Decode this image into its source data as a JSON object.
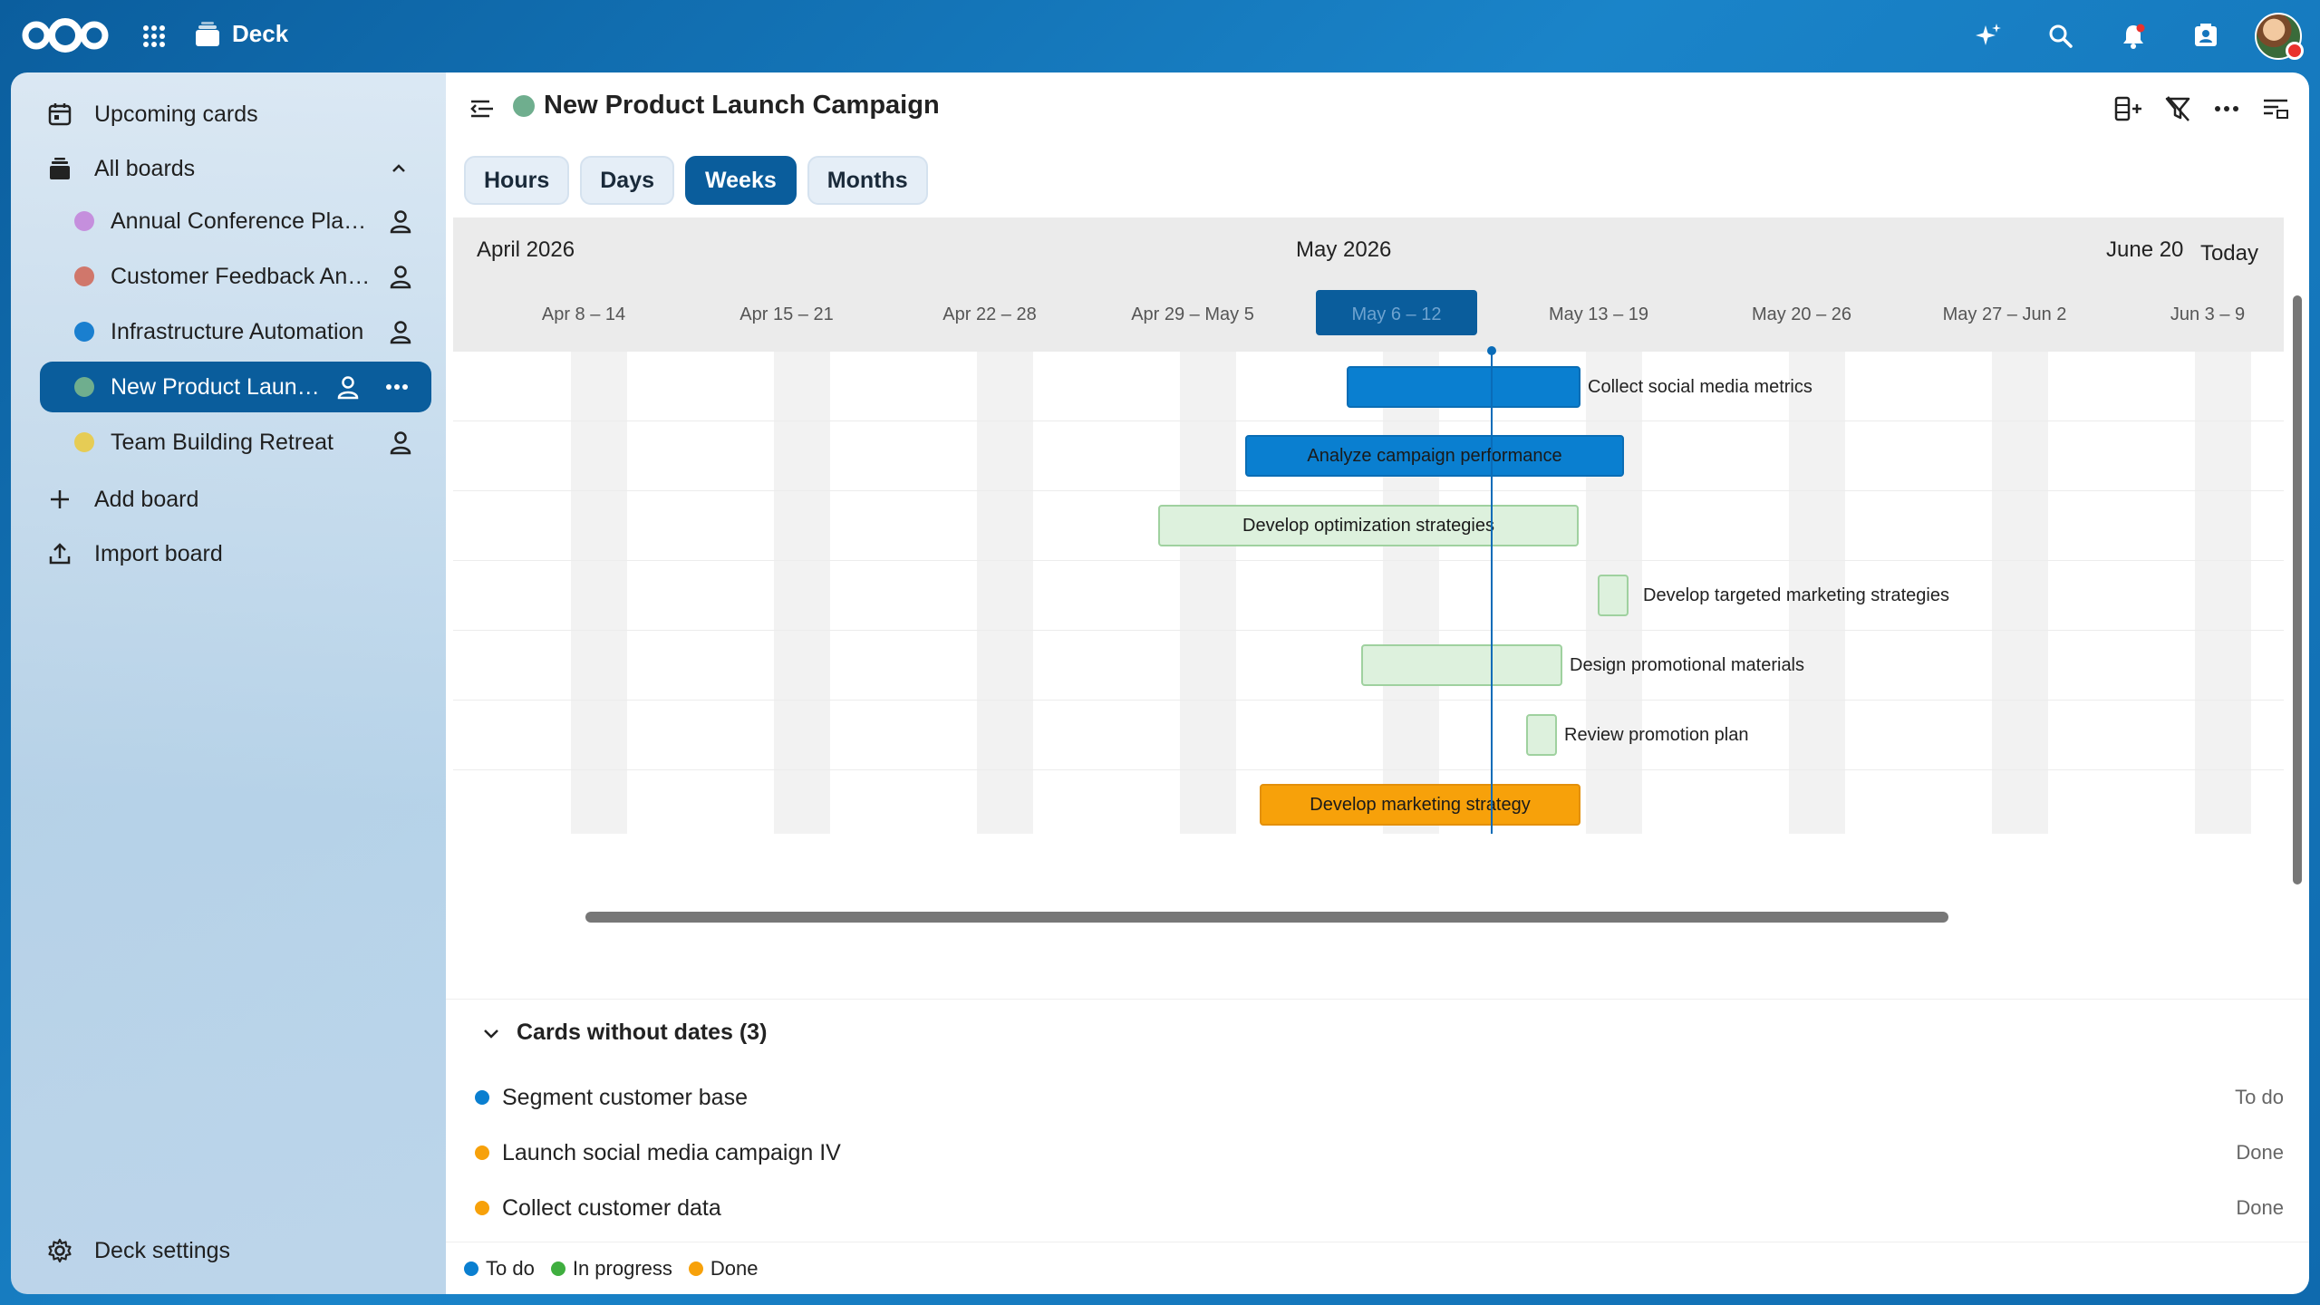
{
  "topbar": {
    "app_name": "Deck",
    "icons": [
      "assistant-icon",
      "search-icon",
      "notifications-icon",
      "contacts-icon",
      "avatar"
    ]
  },
  "sidebar": {
    "upcoming": "Upcoming cards",
    "all_boards": "All boards",
    "boards": [
      {
        "name": "Annual Conference Planning",
        "color": "#c58fdd"
      },
      {
        "name": "Customer Feedback Analy...",
        "color": "#d0776b"
      },
      {
        "name": "Infrastructure Automation",
        "color": "#1a7fcf"
      },
      {
        "name": "New Product Launch ...",
        "color": "#6fae8e"
      },
      {
        "name": "Team Building Retreat",
        "color": "#e6cc55"
      }
    ],
    "add_board": "Add board",
    "import_board": "Import board",
    "deck_settings": "Deck settings"
  },
  "board": {
    "title": "New Product Launch Campaign",
    "color": "#6fae8e"
  },
  "view_tabs": [
    "Hours",
    "Days",
    "Weeks",
    "Months"
  ],
  "active_tab": "Weeks",
  "gantt": {
    "months": [
      "April 2026",
      "May 2026",
      "June 20"
    ],
    "today_label": "Today",
    "weeks": [
      "Apr 8 – 14",
      "Apr 15 – 21",
      "Apr 22 – 28",
      "Apr 29 – May 5",
      "May 6 – 12",
      "May 13 – 19",
      "May 20 – 26",
      "May 27 – Jun 2",
      "Jun 3 – 9"
    ],
    "selected_week": "May 6 – 12",
    "tasks": [
      {
        "name": "Collect social media metrics",
        "status": "todo"
      },
      {
        "name": "Analyze campaign performance",
        "status": "todo"
      },
      {
        "name": "Develop optimization strategies",
        "status": "in-progress"
      },
      {
        "name": "Develop targeted marketing strategies",
        "status": "in-progress"
      },
      {
        "name": "Design promotional materials",
        "status": "in-progress"
      },
      {
        "name": "Review promotion plan",
        "status": "in-progress"
      },
      {
        "name": "Develop marketing strategy",
        "status": "done"
      }
    ]
  },
  "undated": {
    "heading": "Cards without dates (3)",
    "cards": [
      {
        "name": "Segment customer base",
        "status": "To do",
        "color": "#0a7fd0"
      },
      {
        "name": "Launch social media campaign IV",
        "status": "Done",
        "color": "#f7a10a"
      },
      {
        "name": "Collect customer data",
        "status": "Done",
        "color": "#f7a10a"
      }
    ]
  },
  "legend": [
    {
      "label": "To do",
      "color": "#0a7fd0"
    },
    {
      "label": "In progress",
      "color": "#3fae3f"
    },
    {
      "label": "Done",
      "color": "#f7a10a"
    }
  ]
}
